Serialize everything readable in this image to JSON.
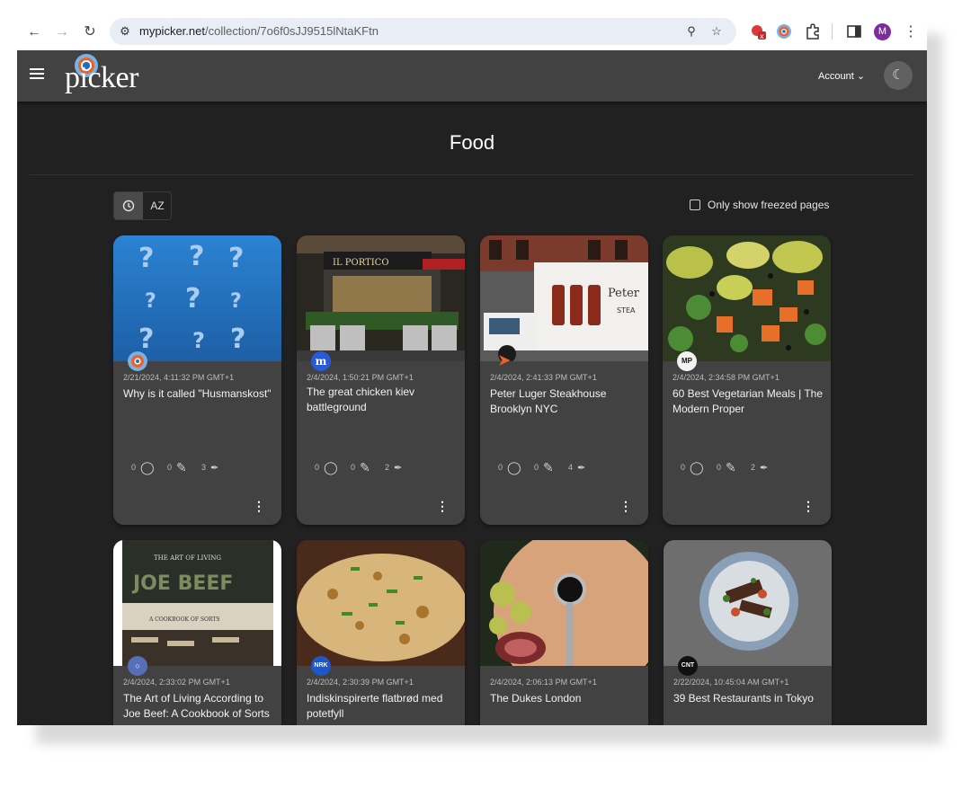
{
  "browser": {
    "url_host": "mypicker.net",
    "url_path": "/collection/7o6f0sJJ9515lNtaKFtn",
    "profile_initial": "M"
  },
  "app": {
    "logo_text": "picker",
    "account_label": "Account"
  },
  "page": {
    "title": "Food",
    "sort_options": [
      "date-sort",
      "alpha-sort"
    ],
    "sort_alpha_label": "AZ",
    "only_freezed_label": "Only show freezed pages",
    "only_freezed_checked": false
  },
  "cards": [
    {
      "date": "2/21/2024, 4:11:32 PM GMT+1",
      "title": "Why is it called \"Husmanskost\"",
      "tags": "0",
      "notes": "0",
      "highlights": "3",
      "favicon": "picker-icon"
    },
    {
      "date": "2/4/2024, 1:50:21 PM GMT+1",
      "title": "The great chicken kiev battleground",
      "tags": "0",
      "notes": "0",
      "highlights": "2",
      "favicon": "m-icon"
    },
    {
      "date": "2/4/2024, 2:41:33 PM GMT+1",
      "title": "Peter Luger Steakhouse Brooklyn NYC",
      "tags": "0",
      "notes": "0",
      "highlights": "4",
      "favicon": "arrow-icon"
    },
    {
      "date": "2/4/2024, 2:34:58 PM GMT+1",
      "title": "60 Best Vegetarian Meals | The Modern Proper",
      "tags": "0",
      "notes": "0",
      "highlights": "2",
      "favicon": "mp-icon"
    },
    {
      "date": "2/4/2024, 2:33:02 PM GMT+1",
      "title": "The Art of Living According to Joe Beef: A Cookbook of Sorts",
      "favicon": "globe-icon"
    },
    {
      "date": "2/4/2024, 2:30:39 PM GMT+1",
      "title": "Indiskinspirerte flatbrød med potetfyll",
      "favicon": "nrk-icon"
    },
    {
      "date": "2/4/2024, 2:06:13 PM GMT+1",
      "title": "The Dukes London",
      "favicon": ""
    },
    {
      "date": "2/22/2024, 10:45:04 AM GMT+1",
      "title": "39 Best Restaurants in Tokyo",
      "favicon": "cnt-icon"
    }
  ],
  "favicon_labels": {
    "m": "m",
    "mp": "MP",
    "nrk": "NRK",
    "cnt": "CNT"
  }
}
